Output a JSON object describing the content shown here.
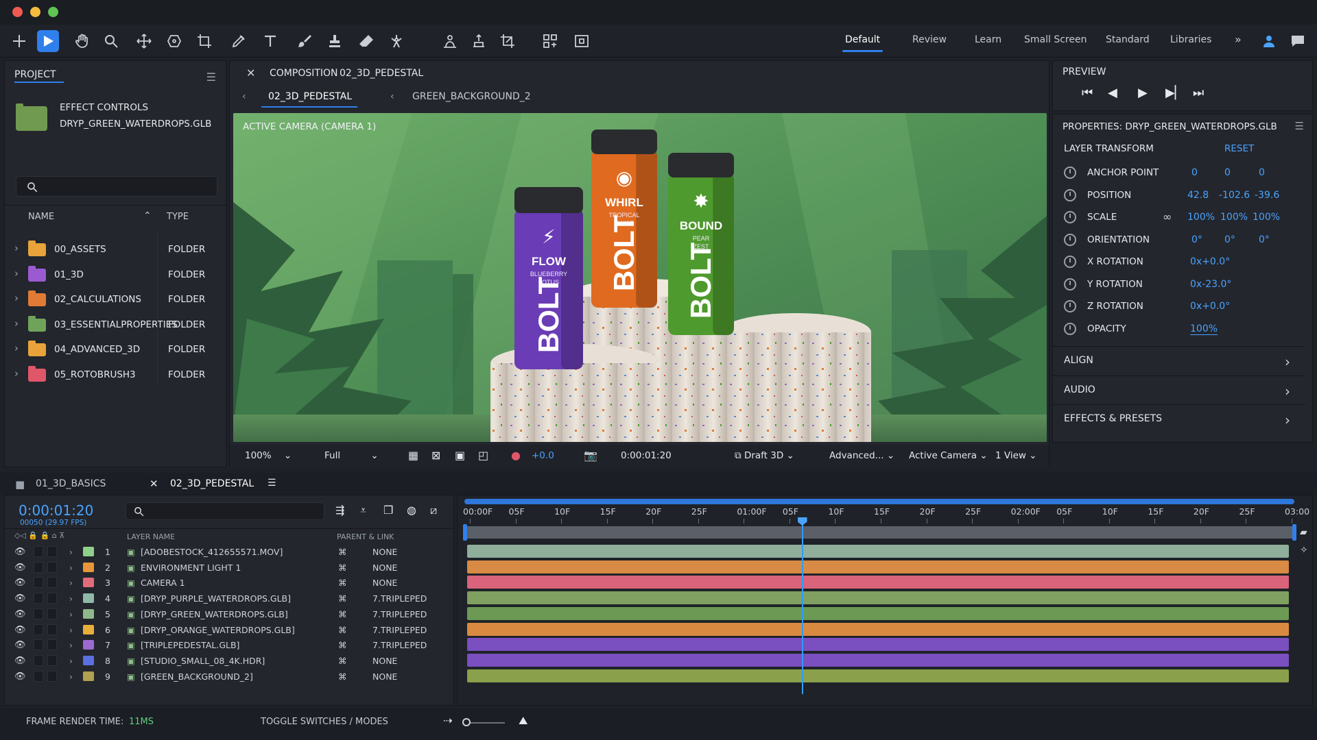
{
  "toolbar": {
    "tools": [
      "move-icon",
      "selection-icon",
      "hand-icon",
      "zoom-icon",
      "orbit-icon",
      "pan-behind-icon",
      "crop-icon",
      "pen-icon",
      "text-icon",
      "brush-icon",
      "stamp-icon",
      "eraser-icon",
      "puppet-icon",
      "roto-icon",
      "extract-icon",
      "track-icon",
      "snap-icon",
      "align-icon"
    ],
    "workspaces": [
      "Default",
      "Review",
      "Learn",
      "Small Screen",
      "Standard",
      "Libraries"
    ],
    "more": "»"
  },
  "project": {
    "title": "PROJECT",
    "effect_controls_line1": "EFFECT CONTROLS",
    "effect_controls_line2": "DRYP_GREEN_WATERDROPS.GLB",
    "col_name": "NAME",
    "col_type": "TYPE",
    "items": [
      {
        "name": "00_ASSETS",
        "type": "FOLDER",
        "color": "#e8a33a"
      },
      {
        "name": "01_3D",
        "type": "FOLDER",
        "color": "#9b5bd0"
      },
      {
        "name": "02_CALCULATIONS",
        "type": "FOLDER",
        "color": "#e07b35"
      },
      {
        "name": "03_ESSENTIALPROPERTIES",
        "type": "FOLDER",
        "color": "#6fa35a"
      },
      {
        "name": "04_ADVANCED_3D",
        "type": "FOLDER",
        "color": "#e8a33a"
      },
      {
        "name": "05_ROTOBRUSH3",
        "type": "FOLDER",
        "color": "#e0576a"
      }
    ]
  },
  "composition": {
    "header": "COMPOSITION",
    "header_name": "02_3D_PEDESTAL",
    "tab_active": "02_3D_PEDESTAL",
    "tab_other": "GREEN_BACKGROUND_2",
    "camera_label": "ACTIVE CAMERA (CAMERA 1)",
    "cans": [
      {
        "flavor": "FLOW",
        "sub1": "BLUEBERRY",
        "sub2": "LOTUS",
        "brand": "BOLT",
        "color": "#6a3cb5"
      },
      {
        "flavor": "WHIRL",
        "sub1": "TROPICAL",
        "sub2": "TWIST",
        "brand": "BOLT",
        "color": "#e06a1f"
      },
      {
        "flavor": "BOUND",
        "sub1": "PEAR",
        "sub2": "ZEST",
        "brand": "BOLT",
        "color": "#4f9a2e"
      }
    ],
    "footer": {
      "zoom": "100%",
      "resolution": "Full",
      "exposure": "+0.0",
      "timecode": "0:00:01:20",
      "renderer": "Draft 3D",
      "advanced": "Advanced...",
      "camera": "Active Camera",
      "views": "1 View"
    }
  },
  "preview": {
    "title": "PREVIEW"
  },
  "properties": {
    "title": "PROPERTIES: DRYP_GREEN_WATERDROPS.GLB",
    "section": "LAYER TRANSFORM",
    "reset": "RESET",
    "rows": [
      {
        "label": "ANCHOR POINT",
        "v1": "0",
        "v2": "0",
        "v3": "0"
      },
      {
        "label": "POSITION",
        "v1": "42.8",
        "v2": "-102.6",
        "v3": "-39.6"
      },
      {
        "label": "SCALE",
        "v1": "100%",
        "v2": "100%",
        "v3": "100%"
      },
      {
        "label": "ORIENTATION",
        "v1": "0°",
        "v2": "0°",
        "v3": "0°"
      },
      {
        "label": "X ROTATION",
        "v1": "0x+0.0°",
        "v2": "",
        "v3": ""
      },
      {
        "label": "Y ROTATION",
        "v1": "0x-23.0°",
        "v2": "",
        "v3": ""
      },
      {
        "label": "Z ROTATION",
        "v1": "0x+0.0°",
        "v2": "",
        "v3": ""
      },
      {
        "label": "OPACITY",
        "v1": "100%",
        "v2": "",
        "v3": ""
      }
    ],
    "sections": [
      "ALIGN",
      "AUDIO",
      "EFFECTS & PRESETS"
    ]
  },
  "timeline": {
    "tab1": "01_3D_BASICS",
    "tab2": "02_3D_PEDESTAL",
    "timecode": "0:00:01:20",
    "frames": "00050 (29.97 FPS)",
    "col_layer": "LAYER NAME",
    "col_parent": "PARENT & LINK",
    "ruler": [
      "00:00F",
      "05F",
      "10F",
      "15F",
      "20F",
      "25F",
      "01:00F",
      "05F",
      "10F",
      "15F",
      "20F",
      "25F",
      "02:00F",
      "05F",
      "10F",
      "15F",
      "20F",
      "25F",
      "03:00"
    ],
    "playhead_fraction": 0.407,
    "layers": [
      {
        "num": "1",
        "name": "[ADOBESTOCK_412655571.MOV]",
        "parent": "NONE",
        "label_color": "#8fd08a",
        "bar_color": "#8fae9b"
      },
      {
        "num": "2",
        "name": "ENVIRONMENT LIGHT 1",
        "parent": "NONE",
        "label_color": "#e8963a",
        "bar_color": "#d98a45"
      },
      {
        "num": "3",
        "name": "CAMERA 1",
        "parent": "NONE",
        "label_color": "#e26b7a",
        "bar_color": "#d8637a"
      },
      {
        "num": "4",
        "name": "[DRYP_PURPLE_WATERDROPS.GLB]",
        "parent": "7.TRIPLEPED",
        "label_color": "#8fb9a8",
        "bar_color": "#7fa060"
      },
      {
        "num": "5",
        "name": "[DRYP_GREEN_WATERDROPS.GLB]",
        "parent": "7.TRIPLEPED",
        "label_color": "#8fb98a",
        "bar_color": "#6c9a55"
      },
      {
        "num": "6",
        "name": "[DRYP_ORANGE_WATERDROPS.GLB]",
        "parent": "7.TRIPLEPED",
        "label_color": "#e8b03a",
        "bar_color": "#d98a40"
      },
      {
        "num": "7",
        "name": "[TRIPLEPEDESTAL.GLB]",
        "parent": "7.TRIPLEPED",
        "label_color": "#9b6ad0",
        "bar_color": "#7a4fbf"
      },
      {
        "num": "8",
        "name": "[STUDIO_SMALL_08_4K.HDR]",
        "parent": "NONE",
        "label_color": "#5a6fe0",
        "bar_color": "#7a4fbf"
      },
      {
        "num": "9",
        "name": "[GREEN_BACKGROUND_2]",
        "parent": "NONE",
        "label_color": "#b0a050",
        "bar_color": "#8aa04a"
      }
    ]
  },
  "status": {
    "render_label": "FRAME RENDER TIME:",
    "render_value": "11MS",
    "toggle": "TOGGLE SWITCHES / MODES"
  }
}
